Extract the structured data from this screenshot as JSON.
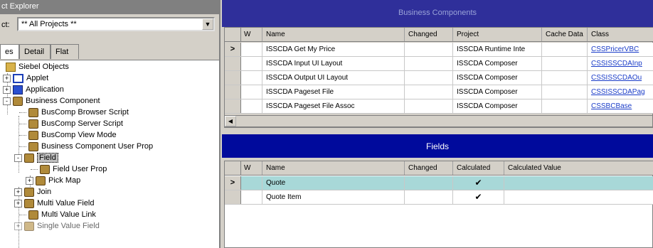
{
  "left_panel": {
    "title": "ct Explorer",
    "project_label": "ct:",
    "project_value": "** All Projects **",
    "tabs": [
      "es",
      "Detail",
      "Flat"
    ],
    "tree": [
      {
        "label": "Siebel Objects",
        "icon": "folder-icon"
      },
      {
        "label": "Applet",
        "icon": "applet-icon",
        "toggle": "+"
      },
      {
        "label": "Application",
        "icon": "application-icon",
        "toggle": "+"
      },
      {
        "label": "Business Component",
        "icon": "business-component-icon",
        "toggle": "-"
      },
      {
        "label": "BusComp Browser Script",
        "icon": "business-component-icon"
      },
      {
        "label": "BusComp Server Script",
        "icon": "business-component-icon"
      },
      {
        "label": "BusComp View Mode",
        "icon": "business-component-icon"
      },
      {
        "label": "Business Component User Prop",
        "icon": "business-component-icon"
      },
      {
        "label": "Field",
        "icon": "business-component-icon",
        "toggle": "-"
      },
      {
        "label": "Field User Prop",
        "icon": "business-component-icon"
      },
      {
        "label": "Pick Map",
        "icon": "business-component-icon",
        "toggle": "+"
      },
      {
        "label": "Join",
        "icon": "business-component-icon",
        "toggle": "+"
      },
      {
        "label": "Multi Value Field",
        "icon": "business-component-icon",
        "toggle": "+"
      },
      {
        "label": "Multi Value Link",
        "icon": "business-component-icon"
      },
      {
        "label": "Single Value Field",
        "icon": "business-component-icon",
        "toggle": "+"
      }
    ]
  },
  "business_components": {
    "title": "Business Components",
    "columns": [
      "W",
      "Name",
      "Changed",
      "Project",
      "Cache Data",
      "Class"
    ],
    "rows": [
      {
        "indicator": ">",
        "name": "ISSCDA Get My Price",
        "changed": "",
        "project": "ISSCDA Runtime Inte",
        "cache": "",
        "class": "CSSPricerVBC"
      },
      {
        "indicator": "",
        "name": "ISSCDA Input UI Layout",
        "changed": "",
        "project": "ISSCDA Composer",
        "cache": "",
        "class": "CSSISSCDAInp"
      },
      {
        "indicator": "",
        "name": "ISSCDA Output UI Layout",
        "changed": "",
        "project": "ISSCDA Composer",
        "cache": "",
        "class": "CSSISSCDAOu"
      },
      {
        "indicator": "",
        "name": "ISSCDA Pageset File",
        "changed": "",
        "project": "ISSCDA Composer",
        "cache": "",
        "class": "CSSISSCDAPag"
      },
      {
        "indicator": "",
        "name": "ISSCDA Pageset File Assoc",
        "changed": "",
        "project": "ISSCDA Composer",
        "cache": "",
        "class": "CSSBCBase"
      }
    ]
  },
  "fields": {
    "title": "Fields",
    "columns": [
      "W",
      "Name",
      "Changed",
      "Calculated",
      "Calculated Value"
    ],
    "rows": [
      {
        "indicator": ">",
        "name": "Quote",
        "changed": "",
        "calculated": "✔",
        "calc_value": ""
      },
      {
        "indicator": "",
        "name": "Quote Item",
        "changed": "",
        "calculated": "✔",
        "calc_value": ""
      }
    ]
  },
  "colors": {
    "banner_bc": "#2f2f9a",
    "banner_fields": "#000a9c",
    "selected_row": "#a8d8d8"
  }
}
